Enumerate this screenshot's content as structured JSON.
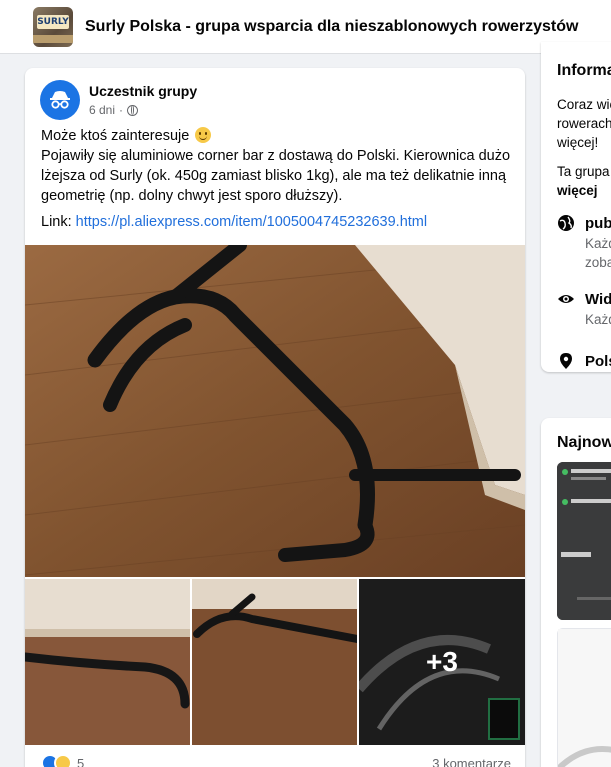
{
  "header": {
    "group_name": "Surly Polska - grupa wsparcia dla nieszablonowych rowerzystów",
    "group_logo_text": "SURLY"
  },
  "post": {
    "author": "Uczestnik grupy",
    "time": "6 dni",
    "privacy_icon": "globe-icon",
    "text_line1": "Może ktoś zainteresuje",
    "text_body": "Pojawiły się aluminiowe corner bar z dostawą do Polski.  Kierownica dużo lżejsza od Surly (ok. 450g zamiast blisko 1kg), ale ma też delikatnie inną geometrię (np. dolny chwyt jest sporo dłuższy).",
    "link_label": "Link:",
    "link_url": "https://pl.aliexpress.com/item/1005004745232639.html",
    "more_photos": "+3",
    "reaction_count": "5",
    "comments": "3 komentarze"
  },
  "sidebar": {
    "about": {
      "title": "Informacje",
      "desc": "Coraz więcej osób jeździ na rowerach Surly się w Polsce… więcej!",
      "desc2_prefix": "Ta grupa…",
      "desc2_more": "więcej",
      "rows": [
        {
          "icon": "globe-icon",
          "title": "publiczna",
          "sub1": "Każdy…",
          "sub2": "zobaczyć…"
        },
        {
          "icon": "eye-icon",
          "title": "Widoczna",
          "sub1": "Każdy…"
        },
        {
          "icon": "location-pin-icon",
          "title": "Polska"
        }
      ]
    },
    "recent": {
      "title": "Najnowsze"
    }
  }
}
